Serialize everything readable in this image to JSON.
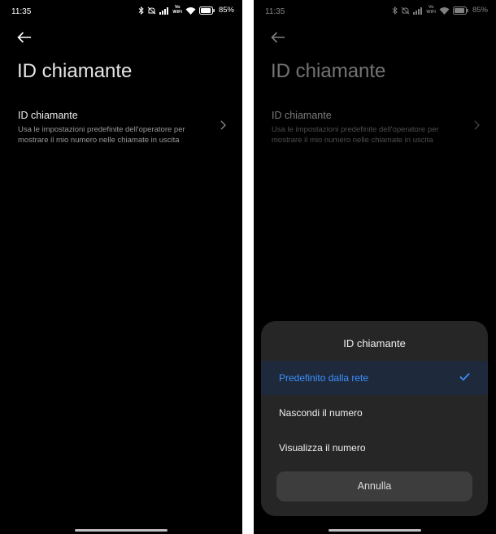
{
  "status": {
    "time": "11:35",
    "vowifi_top": "Vo",
    "vowifi_bottom": "WiFi",
    "battery": "85%"
  },
  "page": {
    "title": "ID chiamante"
  },
  "setting_row": {
    "title": "ID chiamante",
    "description": "Usa le impostazioni predefinite dell'operatore per mostrare il mio numero nelle chiamate in uscita"
  },
  "dialog": {
    "title": "ID chiamante",
    "options": [
      {
        "label": "Predefinito dalla rete",
        "selected": true
      },
      {
        "label": "Nascondi il numero",
        "selected": false
      },
      {
        "label": "Visualizza il numero",
        "selected": false
      }
    ],
    "cancel_label": "Annulla"
  },
  "colors": {
    "background": "#000000",
    "accent": "#3f8fff",
    "sheet": "#262626"
  },
  "icons": [
    "bluetooth-icon",
    "mute-icon",
    "signal-icon",
    "wifi-icon",
    "battery-icon",
    "back-arrow-icon",
    "chevron-right-icon",
    "check-icon"
  ]
}
